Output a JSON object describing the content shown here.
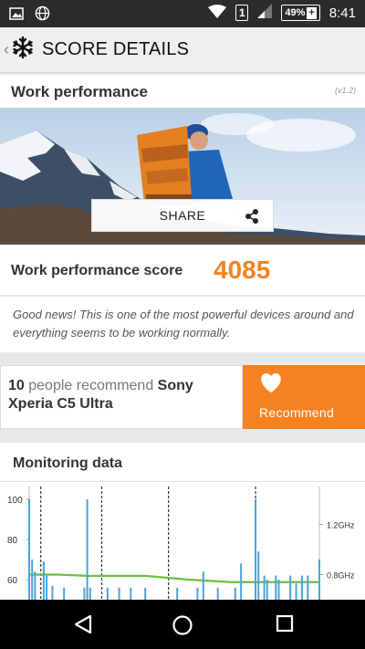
{
  "status_bar": {
    "battery": "49%",
    "sim": "1",
    "time": "8:41",
    "icons": [
      "image-icon",
      "globe-icon",
      "wifi-icon",
      "sim-icon",
      "signal-icon",
      "battery-icon"
    ]
  },
  "app_bar": {
    "title": "SCORE DETAILS",
    "back_icon": "chevron-left-icon",
    "logo_icon": "snowflake-icon"
  },
  "work_performance": {
    "title": "Work performance",
    "version": "(v1.2)",
    "share_label": "SHARE",
    "score_label": "Work performance score",
    "score": "4085",
    "description": "Good news! This is one of the most powerful devices around and everything seems to be working normally."
  },
  "recommend": {
    "count": "10",
    "middle_text": " people recommend ",
    "device": "Sony Xperia C5 Ultra",
    "button_label": "Recommend"
  },
  "monitoring": {
    "title": "Monitoring data"
  },
  "chart_data": {
    "type": "line",
    "title": "",
    "xlabel": "",
    "ylabel": "",
    "y_left_ticks": [
      "100",
      "80",
      "60"
    ],
    "y_right_ticks": [
      "1.2GHz",
      "0.8GHz"
    ],
    "ylim": [
      50,
      100
    ],
    "ylim_right_ghz": [
      0.6,
      1.4
    ],
    "section_markers_x": [
      4,
      25,
      48,
      78
    ],
    "series": [
      {
        "kind": "temperature-bars",
        "color": "#4aa3d8",
        "points": [
          [
            0,
            100
          ],
          [
            1,
            70
          ],
          [
            2,
            64
          ],
          [
            5,
            69
          ],
          [
            6,
            62
          ],
          [
            8,
            57
          ],
          [
            12,
            56
          ],
          [
            19,
            56
          ],
          [
            20,
            100
          ],
          [
            21,
            56
          ],
          [
            27,
            56
          ],
          [
            31,
            56
          ],
          [
            35,
            56
          ],
          [
            40,
            56
          ],
          [
            51,
            56
          ],
          [
            58,
            56
          ],
          [
            60,
            64
          ],
          [
            65,
            56
          ],
          [
            71,
            56
          ],
          [
            73,
            68
          ],
          [
            78,
            100
          ],
          [
            79,
            74
          ],
          [
            81,
            62
          ],
          [
            82,
            60
          ],
          [
            85,
            62
          ],
          [
            86,
            60
          ],
          [
            90,
            62
          ],
          [
            92,
            58
          ],
          [
            94,
            62
          ],
          [
            96,
            62
          ],
          [
            100,
            70
          ]
        ]
      },
      {
        "kind": "cpu-frequency",
        "color": "#6abf40",
        "points": [
          [
            0,
            0.8
          ],
          [
            10,
            0.8
          ],
          [
            20,
            0.79
          ],
          [
            40,
            0.79
          ],
          [
            55,
            0.76
          ],
          [
            70,
            0.74
          ],
          [
            85,
            0.74
          ],
          [
            100,
            0.74
          ]
        ]
      }
    ]
  },
  "nav_bar": {
    "icons": [
      "back-triangle-icon",
      "home-circle-icon",
      "recents-square-icon"
    ]
  }
}
